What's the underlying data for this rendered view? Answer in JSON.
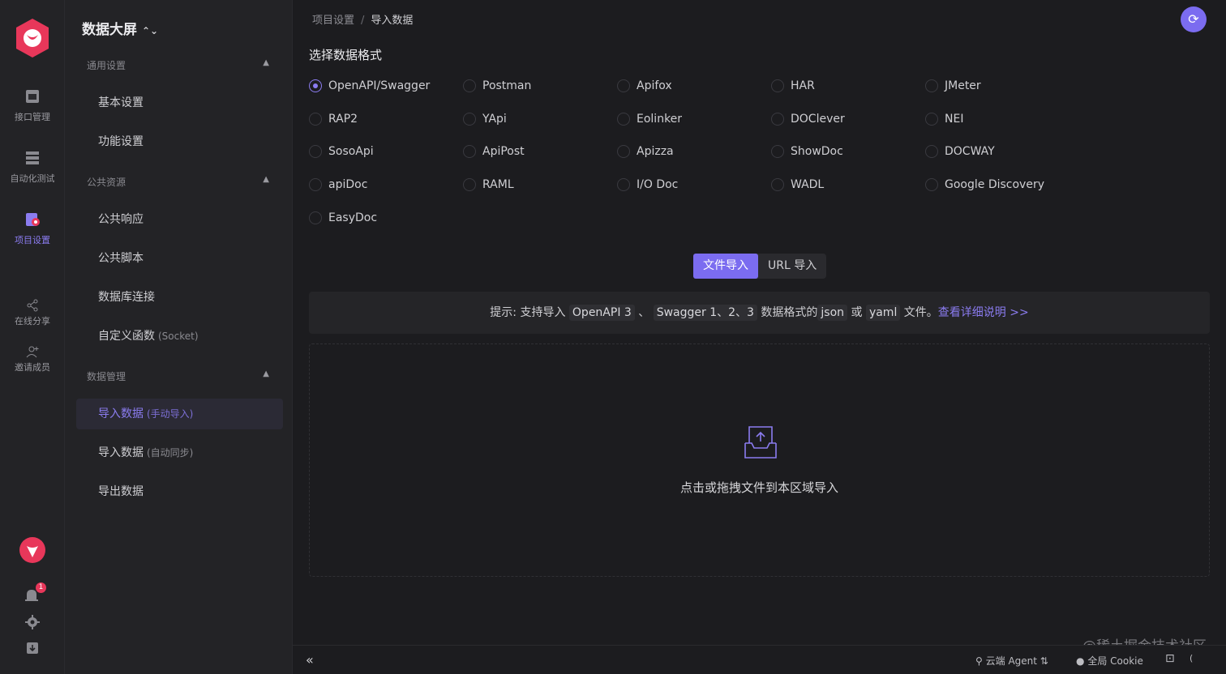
{
  "rail": {
    "items": [
      {
        "label": "接口管理",
        "icon": "api-icon"
      },
      {
        "label": "自动化测试",
        "icon": "automation-icon"
      },
      {
        "label": "项目设置",
        "icon": "project-settings-icon",
        "active": true
      },
      {
        "label": "在线分享",
        "icon": "share-icon"
      },
      {
        "label": "邀请成员",
        "icon": "invite-user-icon"
      }
    ],
    "notification_count": "1"
  },
  "menu": {
    "project_title": "数据大屏",
    "groups": [
      {
        "label": "通用设置",
        "items": [
          {
            "label": "基本设置",
            "sub": ""
          },
          {
            "label": "功能设置",
            "sub": ""
          }
        ]
      },
      {
        "label": "公共资源",
        "items": [
          {
            "label": "公共响应",
            "sub": ""
          },
          {
            "label": "公共脚本",
            "sub": ""
          },
          {
            "label": "数据库连接",
            "sub": ""
          },
          {
            "label": "自定义函数",
            "sub": "(Socket)"
          }
        ]
      },
      {
        "label": "数据管理",
        "items": [
          {
            "label": "导入数据",
            "sub": "(手动导入)",
            "active": true
          },
          {
            "label": "导入数据",
            "sub": "(自动同步)"
          },
          {
            "label": "导出数据",
            "sub": ""
          }
        ]
      }
    ]
  },
  "breadcrumb": {
    "parent": "项目设置",
    "separator": "/",
    "current": "导入数据"
  },
  "main": {
    "section_title": "选择数据格式",
    "formats": [
      "OpenAPI/Swagger",
      "Postman",
      "Apifox",
      "HAR",
      "JMeter",
      "RAP2",
      "YApi",
      "Eolinker",
      "DOClever",
      "NEI",
      "SosoApi",
      "ApiPost",
      "Apizza",
      "ShowDoc",
      "DOCWAY",
      "apiDoc",
      "RAML",
      "I/O Doc",
      "WADL",
      "Google Discovery",
      "EasyDoc"
    ],
    "selected_format": "OpenAPI/Swagger",
    "import_modes": [
      "文件导入",
      "URL 导入"
    ],
    "active_mode": "文件导入",
    "tip": {
      "prefix": "提示: 支持导入",
      "code1": "OpenAPI 3",
      "sep1": "、",
      "code2": "Swagger 1、2、3",
      "mid": "数据格式的",
      "code3": "json",
      "or": "或",
      "code4": "yaml",
      "suffix": "文件。",
      "link": "查看详细说明 >>"
    },
    "drop_text": "点击或拖拽文件到本区域导入"
  },
  "footer": {
    "agent": "云端 Agent",
    "cookie": "全局 Cookie",
    "paren": "(",
    "watermark": "@稀土掘金技术社区"
  },
  "colors": {
    "accent": "#7b6cf0",
    "bg": "#1c1c1f",
    "panel": "#232326",
    "brand": "#e8375a"
  }
}
